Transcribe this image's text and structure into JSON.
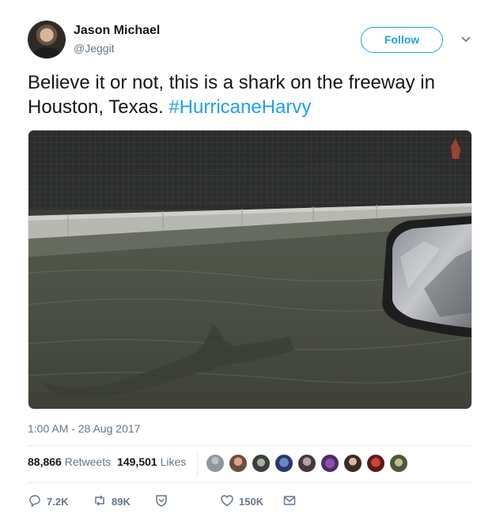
{
  "author": {
    "name": "Jason Michael",
    "handle": "@Jeggit"
  },
  "follow_label": "Follow",
  "tweet": {
    "text": "Believe it or not, this is a shark on the freeway in Houston, Texas. ",
    "hashtag": "#HurricaneHarvy"
  },
  "media": {
    "description": "Photo of flooded freeway"
  },
  "timestamp": "1:00 AM - 28 Aug 2017",
  "stats": {
    "retweets_count": "88,866",
    "retweets_label": "Retweets",
    "likes_count": "149,501",
    "likes_label": "Likes"
  },
  "actions": {
    "reply_count": "7.2K",
    "retweet_count": "89K",
    "like_count": "150K"
  },
  "colors": {
    "accent": "#1da1f2",
    "muted": "#657786",
    "text": "#14171a"
  },
  "icons": [
    "chevron-down-icon",
    "reply-icon",
    "retweet-icon",
    "heart-icon",
    "mail-icon",
    "shield-icon"
  ]
}
